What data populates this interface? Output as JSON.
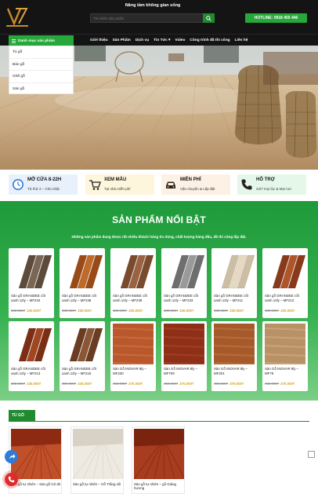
{
  "header": {
    "slogan": "Nâng tầm không gian sống",
    "search_placeholder": "Tìm kiếm sản phẩm",
    "hotline": "HOTLINE: 0918 455 446"
  },
  "nav": {
    "category_button": "Danh mục sản phẩm",
    "menu": [
      "Giới thiệu",
      "Sản Phẩm",
      "Dịch vụ",
      "Tin Tức",
      "Video",
      "Công trình đã thi công",
      "Liên hệ"
    ]
  },
  "categories": [
    "Tủ gỗ",
    "Bàn gỗ",
    "Ghế gỗ",
    "Sàn gỗ"
  ],
  "services": [
    {
      "title": "MỞ CỬA 8-22H",
      "subtitle": "Từ thứ 2 – Chủ nhật",
      "icon": "clock-icon",
      "bg": "#e8f0fb"
    },
    {
      "title": "XEM MẪU",
      "subtitle": "Tại nhà miễn phí",
      "icon": "cart-icon",
      "bg": "#fdf6dc"
    },
    {
      "title": "MIỄN PHÍ",
      "subtitle": "Vận chuyển & Lắp đặt",
      "icon": "car-icon",
      "bg": "#fdf0e4"
    },
    {
      "title": "HỖ TRỢ",
      "subtitle": "24/7 mọi lúc & Mọi nơi",
      "icon": "phone-icon",
      "bg": "#e5f7e8"
    }
  ],
  "featured": {
    "title": "SẢN PHẨM NỔI BẬT",
    "subtitle": "Những sản phẩm đang được rất nhiều khách hàng tin dùng, chất lượng hàng đầu, đã thi công lắp đặt.",
    "products": [
      {
        "name": "Sàn gỗ GRANDEE cốt xanh 12ly – MF234",
        "old_price": "380.000₫",
        "new_price": "330.000₫",
        "swatch": "plank-dark"
      },
      {
        "name": "Sàn gỗ GRANDEE cốt xanh 12ly – MF238",
        "old_price": "380.000₫",
        "new_price": "330.000₫",
        "swatch": "plank-orange"
      },
      {
        "name": "Sàn gỗ GRANDEE cốt xanh 12ly – MF239",
        "old_price": "380.000₫",
        "new_price": "330.000₫",
        "swatch": "plank-brown"
      },
      {
        "name": "Sàn gỗ GRANDEE cốt xanh 12ly – MF233",
        "old_price": "380.000₫",
        "new_price": "330.000₫",
        "swatch": "plank-gray"
      },
      {
        "name": "Sàn gỗ GRANDEE cốt xanh 12ly – MF211",
        "old_price": "380.000₫",
        "new_price": "330.000₫",
        "swatch": "plank-light"
      },
      {
        "name": "Sàn gỗ GRANDEE cốt xanh 12ly – MF212",
        "old_price": "380.000₫",
        "new_price": "330.000₫",
        "swatch": "plank-red"
      },
      {
        "name": "Sàn gỗ GRANDEE cốt xanh 12ly – MF213",
        "old_price": "380.000₫",
        "new_price": "330.000₫",
        "swatch": "plank-redbrown"
      },
      {
        "name": "Sàn gỗ GRANDEE cốt xanh 12ly – MF215",
        "old_price": "380.000₫",
        "new_price": "330.000₫",
        "swatch": "plank-walnut"
      },
      {
        "name": "Sàn Gỗ INOVAR 8ly – MF230",
        "old_price": "450.000₫",
        "new_price": "370.000₫",
        "swatch": "tile-orange"
      },
      {
        "name": "Sàn Gỗ INOVAR 8ly – MF709",
        "old_price": "450.000₫",
        "new_price": "370.000₫",
        "swatch": "tile-red"
      },
      {
        "name": "Sàn Gỗ INOVAR 8ly – MF201",
        "old_price": "450.000₫",
        "new_price": "370.000₫",
        "swatch": "tile-amber"
      },
      {
        "name": "Sàn Gỗ INOVAR 8ly – MF79",
        "old_price": "450.000₫",
        "new_price": "370.000₫",
        "swatch": "tile-tan"
      }
    ]
  },
  "tu_go": {
    "label": "TỦ GỖ",
    "products": [
      {
        "name": "Sàn gỗ tự nhiên – Sàn gỗ Gõ đỏ",
        "swatch": "room-red"
      },
      {
        "name": "Sàn gỗ tự nhiên – Gỗ Trắng sồi",
        "swatch": "room-white"
      },
      {
        "name": "Sàn gỗ tự nhiên – gỗ Giáng hương",
        "swatch": "room-rose"
      }
    ]
  },
  "colors": {
    "brand_green": "#27a83a",
    "header_bg": "#141414",
    "price_new": "#d9a21b"
  }
}
